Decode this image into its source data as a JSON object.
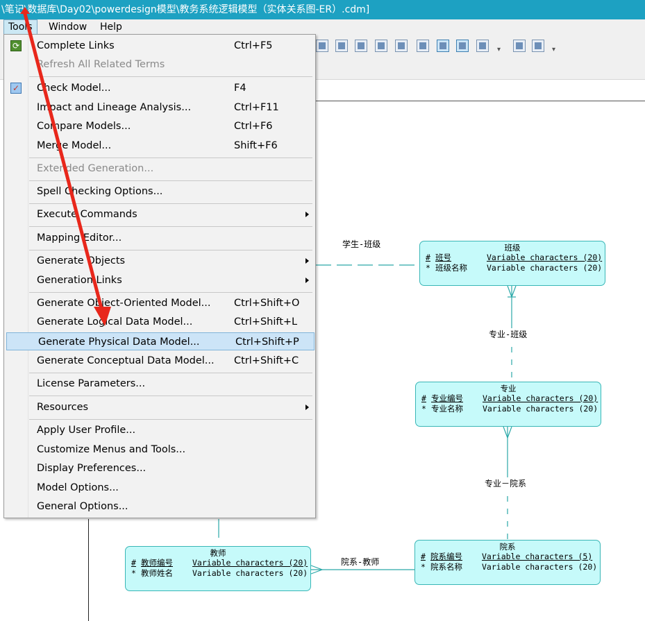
{
  "window": {
    "title": "\\笔记\\数据库\\Day02\\powerdesign模型\\教务系统逻辑模型（实体关系图-ER）.cdm]"
  },
  "menubar": {
    "items": [
      "Tools",
      "Window",
      "Help"
    ],
    "active": "Tools"
  },
  "tools_menu": {
    "items": [
      {
        "label": "Complete Links",
        "shortcut": "Ctrl+F5",
        "icon": "complete-links-icon"
      },
      {
        "label": "Refresh All Related Terms",
        "shortcut": "",
        "disabled": true
      },
      {
        "label": "Check Model...",
        "shortcut": "F4",
        "icon": "check-model-icon"
      },
      {
        "label": "Impact and Lineage Analysis...",
        "shortcut": "Ctrl+F11"
      },
      {
        "label": "Compare Models...",
        "shortcut": "Ctrl+F6"
      },
      {
        "label": "Merge Model...",
        "shortcut": "Shift+F6"
      },
      {
        "label": "Extended Generation...",
        "shortcut": "",
        "disabled": true
      },
      {
        "label": "Spell Checking Options...",
        "shortcut": ""
      },
      {
        "label": "Execute Commands",
        "shortcut": "",
        "submenu": true
      },
      {
        "label": "Mapping Editor...",
        "shortcut": ""
      },
      {
        "label": "Generate Objects",
        "shortcut": "",
        "submenu": true
      },
      {
        "label": "Generation Links",
        "shortcut": "",
        "submenu": true
      },
      {
        "label": "Generate Object-Oriented Model...",
        "shortcut": "Ctrl+Shift+O"
      },
      {
        "label": "Generate Logical Data Model...",
        "shortcut": "Ctrl+Shift+L"
      },
      {
        "label": "Generate Physical Data Model...",
        "shortcut": "Ctrl+Shift+P",
        "highlighted": true
      },
      {
        "label": "Generate Conceptual Data Model...",
        "shortcut": "Ctrl+Shift+C"
      },
      {
        "label": "License Parameters...",
        "shortcut": ""
      },
      {
        "label": "Resources",
        "shortcut": "",
        "submenu": true
      },
      {
        "label": "Apply User Profile...",
        "shortcut": ""
      },
      {
        "label": "Customize Menus and Tools...",
        "shortcut": ""
      },
      {
        "label": "Display Preferences...",
        "shortcut": ""
      },
      {
        "label": "Model Options...",
        "shortcut": ""
      },
      {
        "label": "General Options...",
        "shortcut": ""
      }
    ]
  },
  "diagram": {
    "relationships": {
      "student_class": "学生-班级",
      "major_class": "专业-班级",
      "major_dept": "专业－院系",
      "dept_teacher": "院系-教师"
    },
    "entities": {
      "class": {
        "name": "班级",
        "attrs": [
          {
            "mark": "#",
            "name": "班号",
            "type": "Variable characters (20)",
            "pk": true
          },
          {
            "mark": "*",
            "name": "班级名称",
            "type": "Variable characters (20)",
            "pk": false
          }
        ]
      },
      "major": {
        "name": "专业",
        "attrs": [
          {
            "mark": "#",
            "name": "专业编号",
            "type": "Variable characters (20)",
            "pk": true
          },
          {
            "mark": "*",
            "name": "专业名称",
            "type": "Variable characters (20)",
            "pk": false
          }
        ]
      },
      "dept": {
        "name": "院系",
        "attrs": [
          {
            "mark": "#",
            "name": "院系编号",
            "type": "Variable characters (5)",
            "pk": true
          },
          {
            "mark": "*",
            "name": "院系名称",
            "type": "Variable characters (20)",
            "pk": false
          }
        ]
      },
      "teacher": {
        "name": "教师",
        "attrs": [
          {
            "mark": "#",
            "name": "教师编号",
            "type": "Variable characters (20)",
            "pk": true
          },
          {
            "mark": "*",
            "name": "教师姓名",
            "type": "Variable characters (20)",
            "pk": false
          }
        ]
      }
    }
  },
  "colors": {
    "titlebar": "#1da1c2",
    "entity_fill": "#c6fafa",
    "entity_border": "#39b6b6",
    "highlight": "#cce4f7",
    "annotation_arrow": "#e8271b"
  }
}
